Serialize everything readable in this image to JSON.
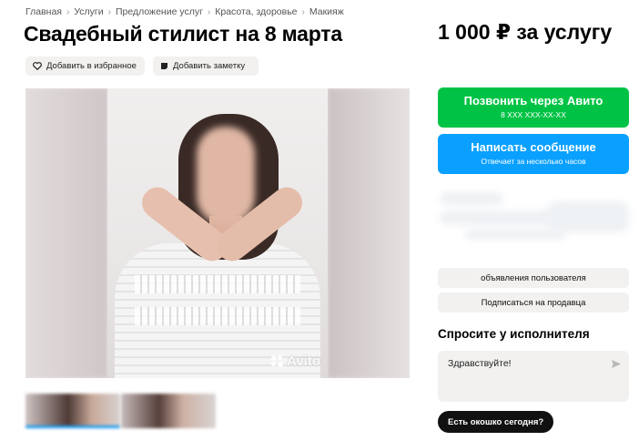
{
  "breadcrumb": [
    "Главная",
    "Услуги",
    "Предложение услуг",
    "Красота, здоровье",
    "Макияж"
  ],
  "listing": {
    "title": "Свадебный стилист на 8 марта",
    "price": "1 000 ₽ за услугу"
  },
  "actions": {
    "favorite_label": "Добавить в избранное",
    "note_label": "Добавить заметку"
  },
  "gallery": {
    "watermark": "Avito"
  },
  "contact": {
    "call_label": "Позвонить через Авито",
    "call_phone": "8 XXX XXX-XX-XX",
    "message_label": "Написать сообщение",
    "message_sub": "Отвечает за несколько часов"
  },
  "seller": {
    "user_ads_label": "объявления пользователя",
    "subscribe_label": "Подписаться на продавца"
  },
  "ask": {
    "title": "Спросите у исполнителя",
    "message_text": "Здравствуйте!",
    "suggestion": "Есть окошко сегодня?"
  },
  "colors": {
    "call_green": "#00c345",
    "message_blue": "#0aa0ff",
    "chip_bg": "#f2f1f0"
  }
}
